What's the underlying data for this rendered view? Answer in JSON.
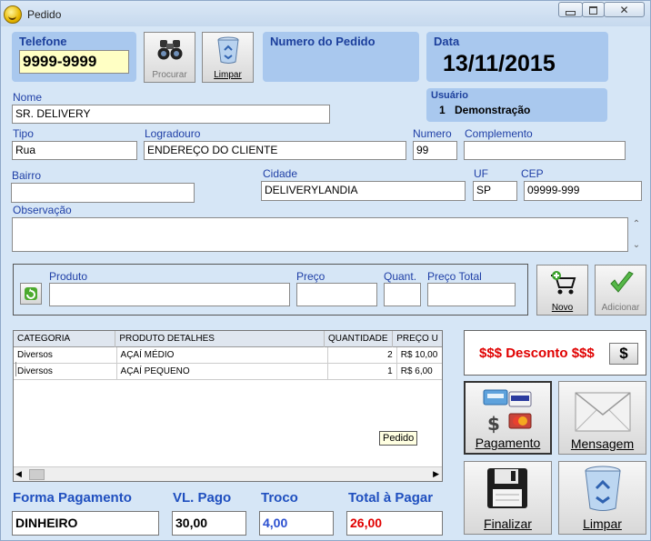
{
  "window": {
    "title": "Pedido",
    "min": "▭",
    "max": "□",
    "close": "✕"
  },
  "telefone": {
    "label": "Telefone",
    "value": "9999-9999"
  },
  "buttons": {
    "procurar": "Procurar",
    "limpar_top": "Limpar",
    "novo": "Novo",
    "adicionar": "Adicionar",
    "desconto_symbol": "$",
    "pagamento": "Pagamento",
    "mensagem": "Mensagem",
    "finalizar": "Finalizar",
    "limpar_bottom": "Limpar"
  },
  "numero_pedido": {
    "label": "Numero do Pedido",
    "value": ""
  },
  "data": {
    "label": "Data",
    "value": "13/11/2015"
  },
  "usuario": {
    "label": "Usuário",
    "id": "1",
    "name": "Demonstração"
  },
  "cliente": {
    "nome_label": "Nome",
    "nome": "SR. DELIVERY",
    "tipo_label": "Tipo",
    "tipo": "Rua",
    "logradouro_label": "Logradouro",
    "logradouro": "ENDEREÇO DO CLIENTE",
    "numero_label": "Numero",
    "numero": "99",
    "complemento_label": "Complemento",
    "complemento": "",
    "bairro_label": "Bairro",
    "bairro": "",
    "cidade_label": "Cidade",
    "cidade": "DELIVERYLANDIA",
    "uf_label": "UF",
    "uf": "SP",
    "cep_label": "CEP",
    "cep": "09999-999",
    "observacao_label": "Observação",
    "observacao": ""
  },
  "produto": {
    "produto_label": "Produto",
    "produto": "",
    "preco_label": "Preço",
    "preco": "",
    "quant_label": "Quant.",
    "quant": "",
    "preco_total_label": "Preço Total",
    "preco_total": ""
  },
  "grid": {
    "headers": [
      "CATEGORIA",
      "PRODUTO DETALHES",
      "QUANTIDADE",
      "PREÇO U"
    ],
    "rows": [
      [
        "Diversos",
        "AÇAÍ MÉDIO",
        "2",
        "R$ 10,00"
      ],
      [
        "Diversos",
        "AÇAÍ PEQUENO",
        "1",
        "R$ 6,00"
      ]
    ],
    "tooltip": "Pedido"
  },
  "desconto": {
    "label": "$$$ Desconto $$$"
  },
  "footer": {
    "forma_pagamento_label": "Forma Pagamento",
    "forma_pagamento": "DINHEIRO",
    "vl_pago_label": "VL. Pago",
    "vl_pago": "30,00",
    "troco_label": "Troco",
    "troco": "4,00",
    "total_label": "Total à Pagar",
    "total": "26,00"
  },
  "colors": {
    "label_blue": "#1f3fa6",
    "panel": "#a9c8ee",
    "background": "#d6e6f6",
    "desconto_red": "#e00000",
    "troco_blue": "#2a4fd0",
    "total_red": "#e00000"
  },
  "icons": [
    "smiley-icon",
    "binoculars-icon",
    "recycle-bin-icon",
    "refresh-icon",
    "cart-add-icon",
    "checkmark-icon",
    "credit-cards-icon",
    "envelope-icon",
    "floppy-disk-icon"
  ]
}
